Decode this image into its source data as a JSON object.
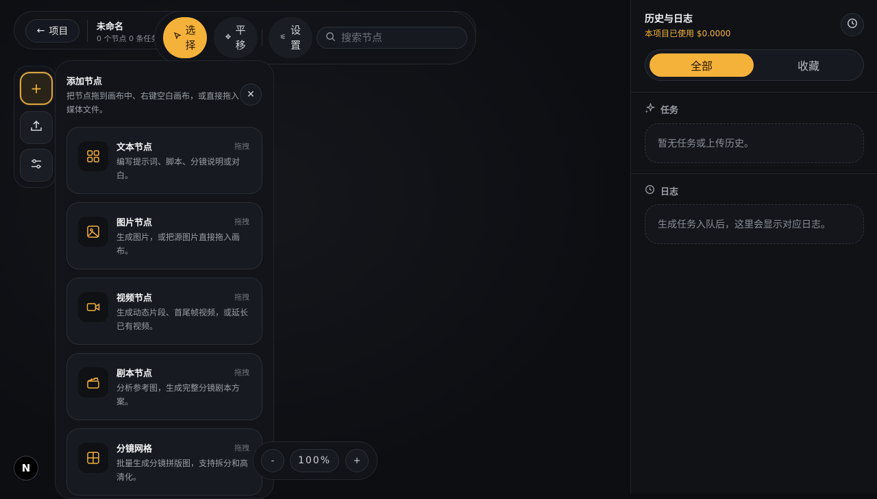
{
  "header": {
    "back_label": "项目",
    "project_title": "未命名",
    "project_sub": "0 个节点 0 条任务"
  },
  "tools": {
    "select_label": "选择",
    "pan_label": "平移",
    "settings_label": "设置",
    "search_placeholder": "搜索节点"
  },
  "panel": {
    "title": "添加节点",
    "desc": "把节点拖到画布中、右键空白画布，或直接拖入媒体文件。",
    "cards": [
      {
        "title": "文本节点",
        "drag": "拖拽",
        "desc": "编写提示词、脚本、分镜说明或对白。",
        "icon": "grid-icon"
      },
      {
        "title": "图片节点",
        "drag": "拖拽",
        "desc": "生成图片，或把源图片直接拖入画布。",
        "icon": "image-icon"
      },
      {
        "title": "视频节点",
        "drag": "拖拽",
        "desc": "生成动态片段、首尾帧视频，或延长已有视频。",
        "icon": "video-icon"
      },
      {
        "title": "剧本节点",
        "drag": "拖拽",
        "desc": "分析参考图，生成完整分镜剧本方案。",
        "icon": "clapper-icon"
      },
      {
        "title": "分镜网格",
        "drag": "拖拽",
        "desc": "批量生成分镜拼版图，支持拆分和高清化。",
        "icon": "panel-grid-icon"
      }
    ]
  },
  "zoom": {
    "minus": "-",
    "value": "100%",
    "plus": "+"
  },
  "badge": "N",
  "sidebar": {
    "title": "历史与日志",
    "usage": "本项目已使用 $0.0000",
    "tab_all": "全部",
    "tab_fav": "收藏",
    "tasks_label": "任务",
    "tasks_empty": "暂无任务或上传历史。",
    "log_label": "日志",
    "log_empty": "生成任务入队后，这里会显示对应日志。"
  },
  "colors": {
    "accent": "#f5b23a",
    "background": "#0b0d11"
  }
}
